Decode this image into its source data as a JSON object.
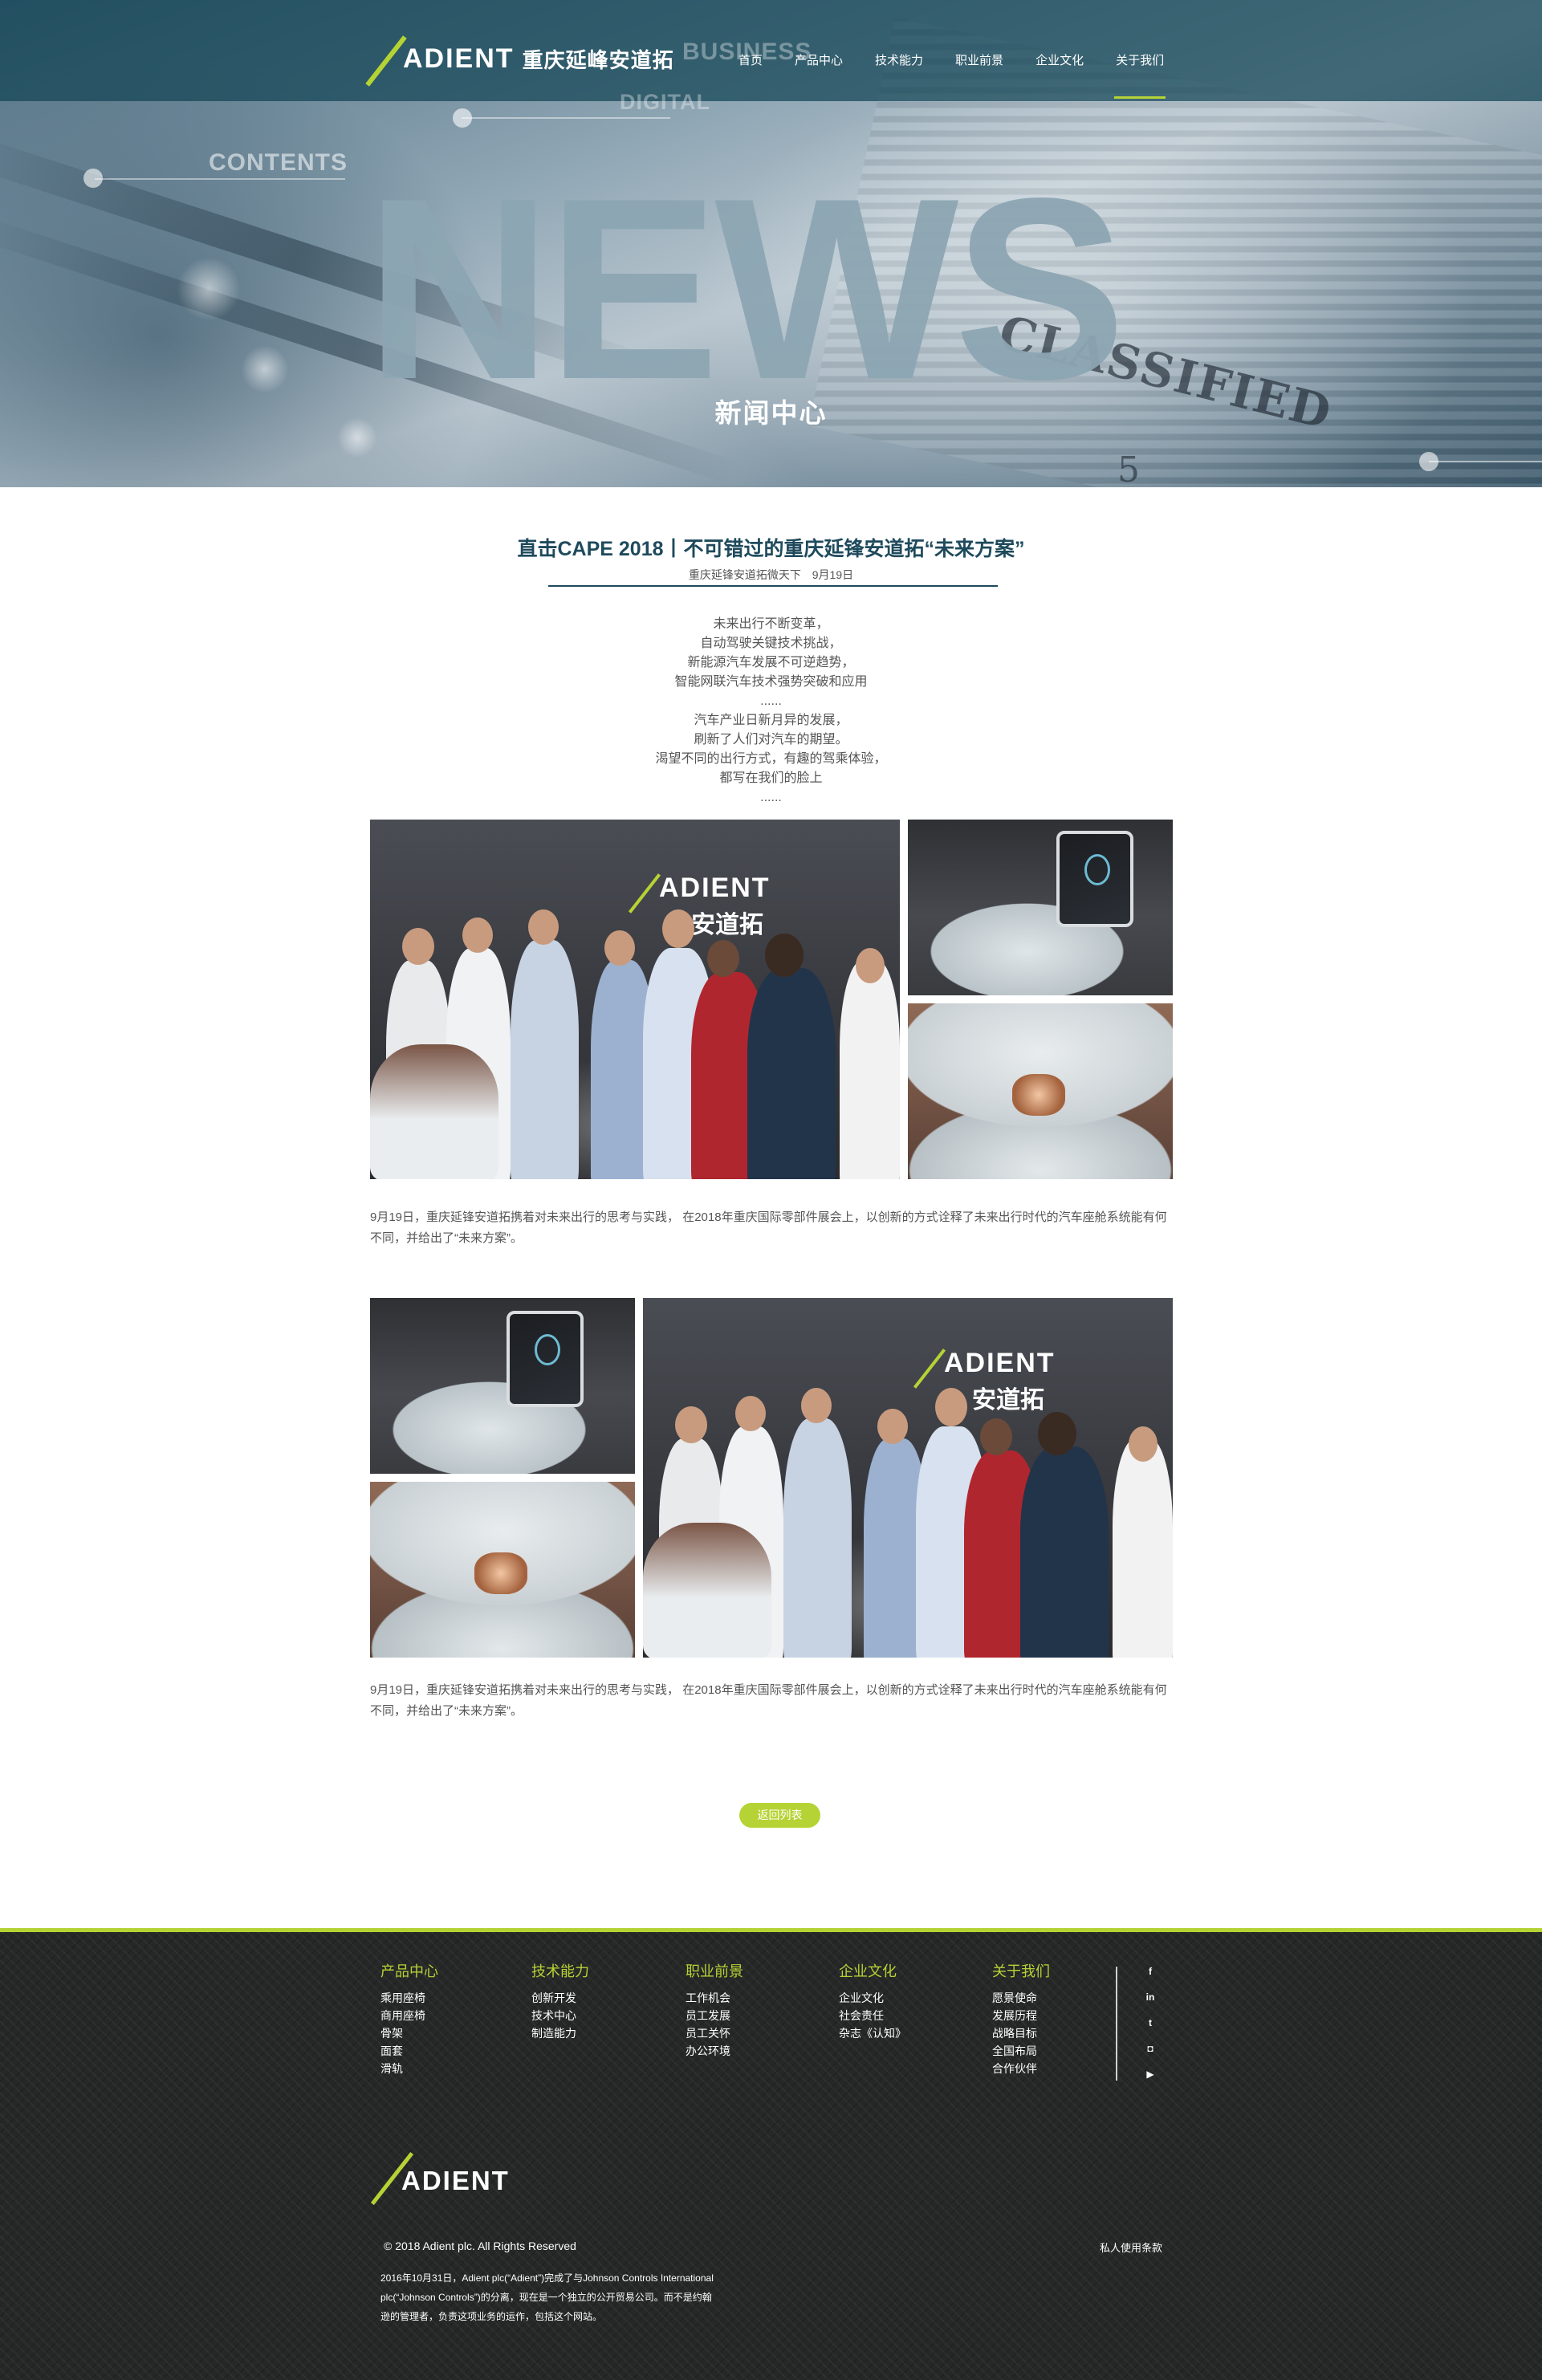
{
  "header": {
    "logo_word": "ADIENT",
    "logo_cn": "重庆延峰安道拓",
    "nav": [
      {
        "label": "首页",
        "active": false
      },
      {
        "label": "产品中心",
        "active": false
      },
      {
        "label": "技术能力",
        "active": false
      },
      {
        "label": "职业前景",
        "active": false
      },
      {
        "label": "企业文化",
        "active": false
      },
      {
        "label": "关于我们",
        "active": true
      }
    ]
  },
  "hero": {
    "ghost_business": "BUSINESS",
    "ghost_digital": "DIGITAL",
    "contents_label": "CONTENTS",
    "big_word": "NEWS",
    "subtitle": "新闻中心",
    "paper_word": "CLASSIFIED",
    "paper_number": "5"
  },
  "article": {
    "title": "直击CAPE 2018丨不可错过的重庆延锋安道拓“未来方案”",
    "source": "重庆延锋安道拓微天下",
    "date": "9月19日",
    "poem": [
      "未来出行不断变革，",
      "自动驾驶关键技术挑战，",
      "新能源汽车发展不可逆趋势，",
      "智能网联汽车技术强势突破和应用",
      "......",
      "汽车产业日新月异的发展，",
      "刷新了人们对汽车的期望。",
      "渴望不同的出行方式，有趣的驾乘体验，",
      "都写在我们的脸上",
      "......"
    ],
    "photo_brand_word": "ADIENT",
    "photo_brand_cn": "安道拓",
    "caption_1": "9月19日，重庆延锋安道拓携着对未来出行的思考与实践，  在2018年重庆国际零部件展会上，以创新的方式诠释了未来出行时代的汽车座舱系统能有何不同，并给出了“未来方案”。",
    "caption_2": "9月19日，重庆延锋安道拓携着对未来出行的思考与实践，  在2018年重庆国际零部件展会上，以创新的方式诠释了未来出行时代的汽车座舱系统能有何不同，并给出了“未来方案”。",
    "back_label": "返回列表"
  },
  "footer": {
    "columns": [
      {
        "title": "产品中心",
        "items": [
          "乘用座椅",
          "商用座椅",
          "骨架",
          "面套",
          "滑轨"
        ]
      },
      {
        "title": "技术能力",
        "items": [
          "创新开发",
          "技术中心",
          "制造能力"
        ]
      },
      {
        "title": "职业前景",
        "items": [
          "工作机会",
          "员工发展",
          "员工关怀",
          "办公环境"
        ]
      },
      {
        "title": "企业文化",
        "items": [
          "企业文化",
          "社会责任",
          "杂志《认知》"
        ]
      },
      {
        "title": "关于我们",
        "items": [
          "愿景使命",
          "发展历程",
          "战略目标",
          "全国布局",
          "合作伙伴"
        ]
      }
    ],
    "social": [
      {
        "icon": "facebook-icon",
        "glyph": "f"
      },
      {
        "icon": "linkedin-icon",
        "glyph": "in"
      },
      {
        "icon": "twitter-icon",
        "glyph": "t"
      },
      {
        "icon": "instagram-icon",
        "glyph": "◘"
      },
      {
        "icon": "youtube-icon",
        "glyph": "▶"
      }
    ],
    "logo_word": "ADIENT",
    "copyright": "© 2018 Adient plc. All Rights Reserved",
    "privacy": "私人使用条款",
    "legal": "2016年10月31日，Adient plc(“Adient”)完成了与Johnson Controls International plc(“Johnson Controls”)的分离，现在是一个独立的公开贸易公司。而不是约翰逊的管理者，负责这项业务的运作，包括这个网站。"
  },
  "colors": {
    "accent_green": "#b5d334",
    "title_teal": "#1e4a5c",
    "header_bar": "#124454",
    "footer_bg": "#262828"
  }
}
